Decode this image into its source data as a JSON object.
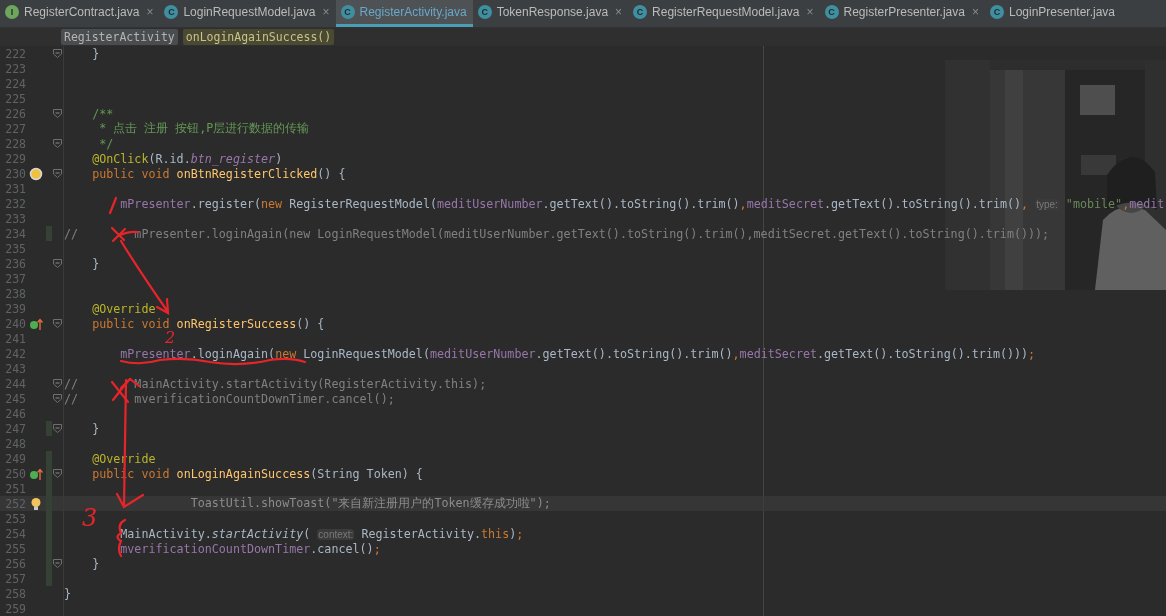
{
  "tabs": [
    {
      "badge": "I",
      "kind": "interface",
      "label": "RegisterContract.java",
      "close": "×",
      "selected": false
    },
    {
      "badge": "C",
      "kind": "class",
      "label": "LoginRequestModel.java",
      "close": "×",
      "selected": false
    },
    {
      "badge": "C",
      "kind": "class",
      "label": "RegisterActivity.java",
      "selected": true
    },
    {
      "badge": "C",
      "kind": "class",
      "label": "TokenResponse.java",
      "close": "×",
      "selected": false
    },
    {
      "badge": "C",
      "kind": "class",
      "label": "RegisterRequestModel.java",
      "close": "×",
      "selected": false
    },
    {
      "badge": "C",
      "kind": "class",
      "label": "RegisterPresenter.java",
      "close": "×",
      "selected": false
    },
    {
      "badge": "C",
      "kind": "class",
      "label": "LoginPresenter.java",
      "selected": false
    }
  ],
  "breadcrumb": [
    {
      "label": "RegisterActivity",
      "kind": "class"
    },
    {
      "label": "onLoginAgainSuccess()",
      "kind": "method"
    }
  ],
  "editor": {
    "lines": [
      {
        "number": "222",
        "fold": true,
        "tokens": [
          {
            "text": "    }",
            "kind": "plain"
          }
        ]
      },
      {
        "number": "223"
      },
      {
        "number": "224"
      },
      {
        "number": "225"
      },
      {
        "number": "226",
        "fold": true,
        "tokens": [
          {
            "text": "    /**",
            "kind": "doc"
          }
        ]
      },
      {
        "number": "227",
        "tokens": [
          {
            "text": "     * 点击 注册 按钮,P层进行数据的传输",
            "kind": "doc"
          }
        ]
      },
      {
        "number": "228",
        "fold": true,
        "tokens": [
          {
            "text": "     */",
            "kind": "doc"
          }
        ]
      },
      {
        "number": "229",
        "tokens": [
          {
            "text": "    @OnClick",
            "kind": "annotation"
          },
          {
            "text": "(R.id.",
            "kind": "plain"
          },
          {
            "text": "btn_register",
            "kind": "static-field"
          },
          {
            "text": ")",
            "kind": "plain"
          }
        ]
      },
      {
        "number": "230",
        "gutter": {
          "kind": "breakpoint"
        },
        "fold": true,
        "tokens": [
          {
            "text": "    public void ",
            "kind": "keyword"
          },
          {
            "text": "onBtnRegisterClicked",
            "kind": "method"
          },
          {
            "text": "() {",
            "kind": "plain"
          }
        ]
      },
      {
        "number": "231"
      },
      {
        "number": "232",
        "tokens": [
          {
            "text": "        mPresenter",
            "kind": "field"
          },
          {
            "text": ".register(",
            "kind": "plain"
          },
          {
            "text": "new ",
            "kind": "keyword"
          },
          {
            "text": "RegisterRequestModel(",
            "kind": "plain"
          },
          {
            "text": "meditUserNumber",
            "kind": "field"
          },
          {
            "text": ".getText().toString().trim()",
            "kind": "plain"
          },
          {
            "text": ",",
            "kind": "keyword"
          },
          {
            "text": "meditSecret",
            "kind": "field"
          },
          {
            "text": ".getText().toString().trim()",
            "kind": "plain"
          },
          {
            "text": ", ",
            "kind": "keyword"
          },
          {
            "text": "type:",
            "kind": "hint"
          },
          {
            "text": " \"mobile\"",
            "kind": "string"
          },
          {
            "text": ",",
            "kind": "keyword"
          },
          {
            "text": "medit",
            "kind": "field"
          }
        ]
      },
      {
        "number": "233"
      },
      {
        "number": "234",
        "changed": true,
        "tokens": [
          {
            "text": "//        mPresenter.loginAgain(new LoginRequestModel(meditUserNumber.getText().toString().trim(),meditSecret.getText().toString().trim()));",
            "kind": "comment"
          }
        ]
      },
      {
        "number": "235"
      },
      {
        "number": "236",
        "fold": true,
        "tokens": [
          {
            "text": "    }",
            "kind": "plain"
          }
        ]
      },
      {
        "number": "237"
      },
      {
        "number": "238"
      },
      {
        "number": "239",
        "tokens": [
          {
            "text": "    @Override",
            "kind": "annotation"
          }
        ]
      },
      {
        "number": "240",
        "gutter": {
          "kind": "override"
        },
        "fold": true,
        "tokens": [
          {
            "text": "    public void ",
            "kind": "keyword"
          },
          {
            "text": "onRegisterSuccess",
            "kind": "method"
          },
          {
            "text": "() {",
            "kind": "plain"
          }
        ]
      },
      {
        "number": "241"
      },
      {
        "number": "242",
        "tokens": [
          {
            "text": "        mPresenter",
            "kind": "field"
          },
          {
            "text": ".loginAgain(",
            "kind": "plain"
          },
          {
            "text": "new ",
            "kind": "keyword"
          },
          {
            "text": "LoginRequestModel(",
            "kind": "plain"
          },
          {
            "text": "meditUserNumber",
            "kind": "field"
          },
          {
            "text": ".getText().toString().trim()",
            "kind": "plain"
          },
          {
            "text": ",",
            "kind": "keyword"
          },
          {
            "text": "meditSecret",
            "kind": "field"
          },
          {
            "text": ".getText().toString().trim()))",
            "kind": "plain"
          },
          {
            "text": ";",
            "kind": "keyword"
          }
        ]
      },
      {
        "number": "243"
      },
      {
        "number": "244",
        "fold": true,
        "tokens": [
          {
            "text": "//        MainActivity.startActivity(RegisterActivity.this);",
            "kind": "comment"
          }
        ]
      },
      {
        "number": "245",
        "fold": true,
        "tokens": [
          {
            "text": "//        mverificationCountDownTimer.cancel();",
            "kind": "comment"
          }
        ]
      },
      {
        "number": "246"
      },
      {
        "number": "247",
        "changed": true,
        "fold": true,
        "tokens": [
          {
            "text": "    }",
            "kind": "plain"
          }
        ]
      },
      {
        "number": "248"
      },
      {
        "number": "249",
        "changed": true,
        "tokens": [
          {
            "text": "    @Override",
            "kind": "annotation"
          }
        ]
      },
      {
        "number": "250",
        "gutter": {
          "kind": "override"
        },
        "changed": true,
        "fold": true,
        "tokens": [
          {
            "text": "    public void ",
            "kind": "keyword"
          },
          {
            "text": "onLoginAgainSuccess",
            "kind": "method"
          },
          {
            "text": "(String Token) {",
            "kind": "plain"
          }
        ]
      },
      {
        "number": "251",
        "changed": true
      },
      {
        "number": "252",
        "gutter": {
          "kind": "bulb"
        },
        "changed": true,
        "current": true,
        "tokens": [
          {
            "text": "                  ToastUtil.showToast(\"来自新注册用户的Token缓存成功啦\");",
            "kind": "dim"
          }
        ]
      },
      {
        "number": "253",
        "changed": true
      },
      {
        "number": "254",
        "changed": true,
        "tokens": [
          {
            "text": "        MainActivity.",
            "kind": "plain"
          },
          {
            "text": "startActivity",
            "kind": "static-method"
          },
          {
            "text": "( ",
            "kind": "plain"
          },
          {
            "text": "context:",
            "kind": "hint"
          },
          {
            "text": " RegisterActivity.",
            "kind": "plain"
          },
          {
            "text": "this",
            "kind": "keyword"
          },
          {
            "text": ")",
            "kind": "plain"
          },
          {
            "text": ";",
            "kind": "keyword"
          }
        ]
      },
      {
        "number": "255",
        "changed": true,
        "tokens": [
          {
            "text": "        mverificationCountDownTimer",
            "kind": "field"
          },
          {
            "text": ".cancel()",
            "kind": "plain"
          },
          {
            "text": ";",
            "kind": "keyword"
          }
        ]
      },
      {
        "number": "256",
        "changed": true,
        "fold": true,
        "tokens": [
          {
            "text": "    }",
            "kind": "plain"
          }
        ]
      },
      {
        "number": "257",
        "changed": true
      },
      {
        "number": "258",
        "tokens": [
          {
            "text": "}",
            "kind": "plain"
          }
        ]
      },
      {
        "number": "259"
      }
    ]
  },
  "ink_marks": [
    {
      "label": "2"
    },
    {
      "label": "3"
    }
  ]
}
